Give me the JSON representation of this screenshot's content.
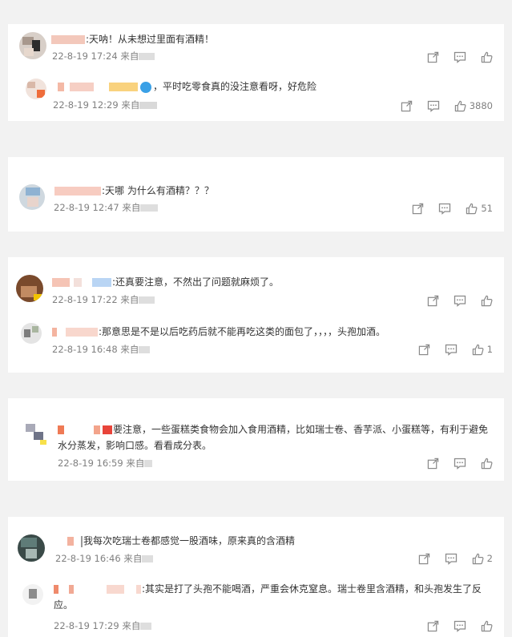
{
  "comments": [
    {
      "id": "c1",
      "text": ":天呐！从未想过里面有酒精！",
      "time": "22-8-19 17:24",
      "source_label": "来自"
    },
    {
      "id": "c2",
      "text": "，平时吃零食真的没注意看呀，好危险",
      "time": "22-8-19 12:29",
      "source_label": "来自",
      "likes": "3880"
    },
    {
      "id": "c3",
      "text": ":天哪 为什么有酒精？？？",
      "time": "22-8-19 12:47",
      "source_label": "来自",
      "likes": "51"
    },
    {
      "id": "c4",
      "text": ":还真要注意，不然出了问题就麻烦了。",
      "time": "22-8-19 17:22",
      "source_label": "来自"
    },
    {
      "id": "c5",
      "text": ":那意思是不是以后吃药后就不能再吃这类的面包了，，，，头孢加酒。",
      "time": "22-8-19 16:48",
      "source_label": "来自",
      "likes": "1"
    },
    {
      "id": "c6",
      "text_line1": "要注意，一些蛋糕类食物会加入食用酒精，比如瑞士卷、香芋派、小蛋糕等，有利于避免",
      "text_line2": "水分蒸发，影响口感。看看成分表。",
      "time": "22-8-19 16:59",
      "source_label": "来自"
    },
    {
      "id": "c7",
      "text": "我每次吃瑞士卷都感觉一股酒味，原来真的含酒精",
      "time": "22-8-19 16:46",
      "source_label": "来自",
      "likes": "2"
    },
    {
      "id": "c8",
      "text_line1": ":其实是打了头孢不能喝酒，严重会休克窒息。瑞士卷里含酒精，和头孢发生了反",
      "text_line2": "应。",
      "time": "22-8-19 17:29",
      "source_label": "来自"
    }
  ],
  "icons": {
    "share": "share-icon",
    "comment": "comment-icon",
    "like": "like-icon"
  },
  "colors": {
    "username": "#eb7350",
    "meta": "#808080",
    "background": "#f2f2f2",
    "card": "#ffffff"
  }
}
